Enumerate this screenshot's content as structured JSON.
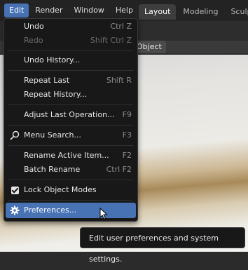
{
  "topbar": {
    "menus": [
      "Edit",
      "Render",
      "Window",
      "Help"
    ],
    "active_menu": "Edit",
    "workspace_tabs": [
      "Layout",
      "Modeling",
      "Sculp"
    ],
    "active_tab": "Layout"
  },
  "viewport": {
    "mode_button": "Object"
  },
  "edit_menu": {
    "items": [
      {
        "label": "Undo",
        "shortcut": "Ctrl Z",
        "enabled": true
      },
      {
        "label": "Redo",
        "shortcut": "Shift Ctrl Z",
        "enabled": false
      },
      {
        "label": "Undo History...",
        "shortcut": "",
        "enabled": true
      },
      {
        "label": "Repeat Last",
        "shortcut": "Shift R",
        "enabled": true
      },
      {
        "label": "Repeat History...",
        "shortcut": "",
        "enabled": true
      },
      {
        "label": "Adjust Last Operation...",
        "shortcut": "F9",
        "enabled": true
      },
      {
        "label": "Menu Search...",
        "shortcut": "F3",
        "enabled": true,
        "icon": "search-icon"
      },
      {
        "label": "Rename Active Item...",
        "shortcut": "F2",
        "enabled": true
      },
      {
        "label": "Batch Rename",
        "shortcut": "Ctrl F2",
        "enabled": true
      },
      {
        "label": "Lock Object Modes",
        "shortcut": "",
        "enabled": true,
        "icon": "checkbox-checked-icon",
        "checked": true
      },
      {
        "label": "Preferences...",
        "shortcut": "",
        "enabled": true,
        "icon": "gear-icon",
        "highlighted": true
      }
    ]
  },
  "tooltip": {
    "text": "Edit user preferences and system settings."
  },
  "colors": {
    "accent": "#4772b3",
    "menu_bg": "#181818",
    "topbar_bg": "#232323"
  }
}
